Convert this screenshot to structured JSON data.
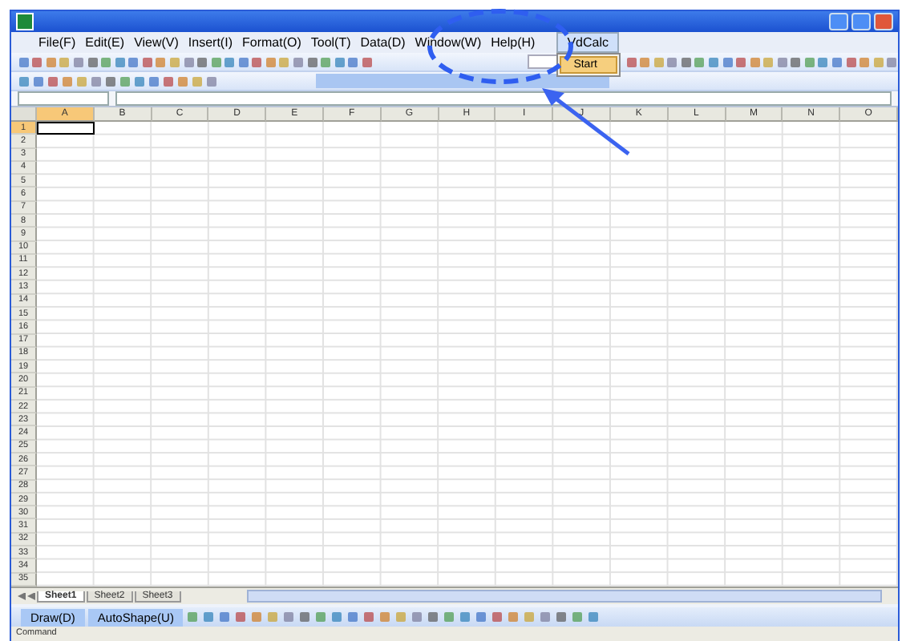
{
  "menu_bar": [
    {
      "label": "File(F)"
    },
    {
      "label": "Edit(E)"
    },
    {
      "label": "View(V)"
    },
    {
      "label": "Insert(I)"
    },
    {
      "label": "Format(O)"
    },
    {
      "label": "Tool(T)"
    },
    {
      "label": "Data(D)"
    },
    {
      "label": "Window(W)"
    },
    {
      "label": "Help(H)"
    }
  ],
  "addin_menu": {
    "title": "VdCalc",
    "items": [
      {
        "label": "Start",
        "selected": true
      }
    ]
  },
  "columns": [
    {
      "label": "A",
      "selected": true
    },
    {
      "label": "B",
      "selected": false
    },
    {
      "label": "C",
      "selected": false
    },
    {
      "label": "D",
      "selected": false
    },
    {
      "label": "E",
      "selected": false
    },
    {
      "label": "F",
      "selected": false
    },
    {
      "label": "G",
      "selected": false
    },
    {
      "label": "H",
      "selected": false
    },
    {
      "label": "I",
      "selected": false
    },
    {
      "label": "J",
      "selected": false
    },
    {
      "label": "K",
      "selected": false
    },
    {
      "label": "L",
      "selected": false
    },
    {
      "label": "M",
      "selected": false
    },
    {
      "label": "N",
      "selected": false
    },
    {
      "label": "O",
      "selected": false
    }
  ],
  "rows": [
    {
      "label": "1",
      "selected": true
    },
    {
      "label": "2",
      "selected": false
    },
    {
      "label": "3",
      "selected": false
    },
    {
      "label": "4",
      "selected": false
    },
    {
      "label": "5",
      "selected": false
    },
    {
      "label": "6",
      "selected": false
    },
    {
      "label": "7",
      "selected": false
    },
    {
      "label": "8",
      "selected": false
    },
    {
      "label": "9",
      "selected": false
    },
    {
      "label": "10",
      "selected": false
    },
    {
      "label": "11",
      "selected": false
    },
    {
      "label": "12",
      "selected": false
    },
    {
      "label": "13",
      "selected": false
    },
    {
      "label": "14",
      "selected": false
    },
    {
      "label": "15",
      "selected": false
    },
    {
      "label": "16",
      "selected": false
    },
    {
      "label": "17",
      "selected": false
    },
    {
      "label": "18",
      "selected": false
    },
    {
      "label": "19",
      "selected": false
    },
    {
      "label": "20",
      "selected": false
    },
    {
      "label": "21",
      "selected": false
    },
    {
      "label": "22",
      "selected": false
    },
    {
      "label": "23",
      "selected": false
    },
    {
      "label": "24",
      "selected": false
    },
    {
      "label": "25",
      "selected": false
    },
    {
      "label": "26",
      "selected": false
    },
    {
      "label": "27",
      "selected": false
    },
    {
      "label": "28",
      "selected": false
    },
    {
      "label": "29",
      "selected": false
    },
    {
      "label": "30",
      "selected": false
    },
    {
      "label": "31",
      "selected": false
    },
    {
      "label": "32",
      "selected": false
    },
    {
      "label": "33",
      "selected": false
    },
    {
      "label": "34",
      "selected": false
    },
    {
      "label": "35",
      "selected": false
    }
  ],
  "sheet_tabs": [
    {
      "label": "Sheet1",
      "selected": true
    },
    {
      "label": "Sheet2",
      "selected": false
    },
    {
      "label": "Sheet3",
      "selected": false
    }
  ],
  "draw_toolbar": [
    {
      "label": "Draw(D)"
    },
    {
      "label": "AutoShape(U)"
    }
  ],
  "status_bar": "Command"
}
